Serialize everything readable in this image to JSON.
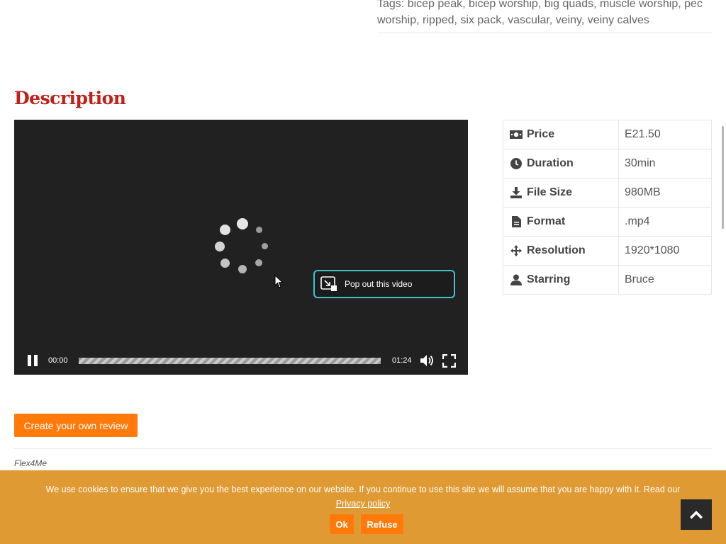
{
  "tags": {
    "prefix": "Tags:",
    "items": [
      "bicep peak",
      "bicep worship",
      "big quads",
      "muscle worship",
      "pec worship",
      "ripped",
      "six pack",
      "vascular",
      "veiny",
      "veiny calves"
    ]
  },
  "description": {
    "title": "Description"
  },
  "player": {
    "current_time": "00:00",
    "duration": "01:24",
    "popout_label": "Pop out this video",
    "state": "loading",
    "popout_border_color": "#3ec4c8"
  },
  "info": {
    "rows": [
      {
        "icon": "money-icon",
        "label": "Price",
        "value": "E21.50"
      },
      {
        "icon": "clock-icon",
        "label": "Duration",
        "value": "30min"
      },
      {
        "icon": "download-icon",
        "label": "File Size",
        "value": "980MB"
      },
      {
        "icon": "file-icon",
        "label": "Format",
        "value": ".mp4"
      },
      {
        "icon": "move-icon",
        "label": "Resolution",
        "value": "1920*1080"
      },
      {
        "icon": "user-icon",
        "label": "Starring",
        "value": "Bruce"
      }
    ]
  },
  "review": {
    "button_label": "Create your own review",
    "author": "Flex4Me"
  },
  "cookie": {
    "message": "We use cookies to ensure that we give you the best experience on our website. If you continue to use this site we will assume that you are happy with it. Read our",
    "link": "Privacy policy",
    "ok_label": "Ok",
    "refuse_label": "Refuse",
    "bar_color": "#e09a33",
    "button_color": "#ff7a0a"
  },
  "colors": {
    "heading": "#c0201a",
    "accent": "#ff7a0a"
  }
}
